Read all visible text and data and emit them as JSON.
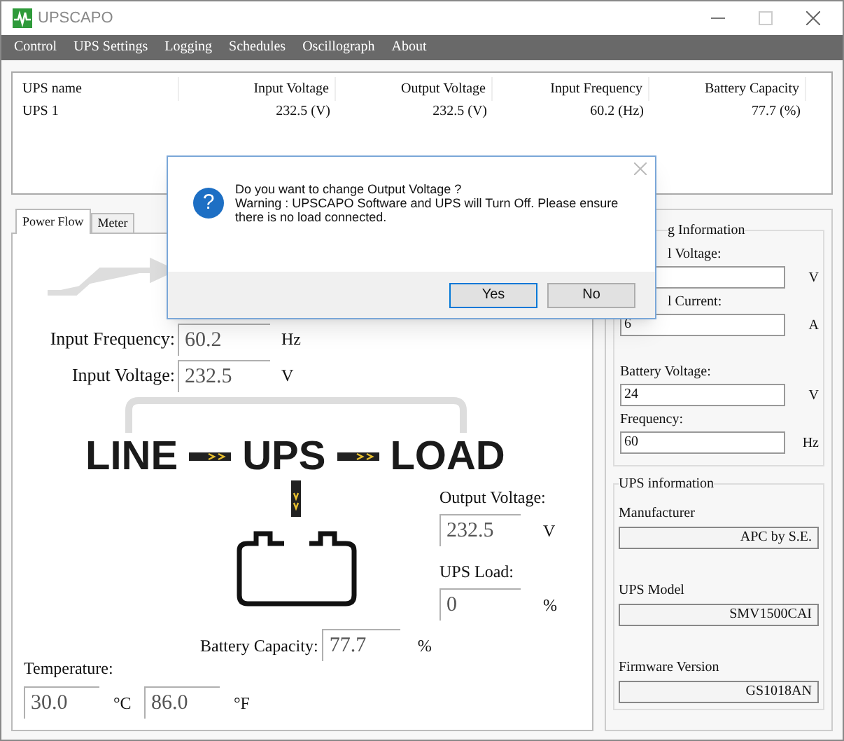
{
  "window": {
    "title": "UPSCAPO"
  },
  "menu": [
    "Control",
    "UPS Settings",
    "Logging",
    "Schedules",
    "Oscillograph",
    "About"
  ],
  "ups_list": {
    "columns": [
      "UPS name",
      "Input Voltage",
      "Output Voltage",
      "Input Frequency",
      "Battery Capacity"
    ],
    "rows": [
      [
        "UPS 1",
        "232.5 (V)",
        "232.5 (V)",
        "60.2 (Hz)",
        "77.7 (%)"
      ]
    ]
  },
  "tabs": [
    {
      "label": "Power Flow",
      "selected": true
    },
    {
      "label": "Meter",
      "selected": false
    }
  ],
  "power_flow": {
    "input_frequency": {
      "label": "Input Frequency:",
      "value": "60.2",
      "unit": "Hz"
    },
    "input_voltage": {
      "label": "Input Voltage:",
      "value": "232.5",
      "unit": "V"
    },
    "nodes": [
      "LINE",
      "UPS",
      "LOAD"
    ],
    "output_voltage": {
      "label": "Output Voltage:",
      "value": "232.5",
      "unit": "V"
    },
    "ups_load": {
      "label": "UPS Load:",
      "value": "0",
      "unit": "%"
    },
    "battery_capacity": {
      "label": "Battery Capacity:",
      "value": "77.7",
      "unit": "%"
    },
    "temperature": {
      "label": "Temperature:",
      "celsius": "30.0",
      "celsius_unit": "°C",
      "fahrenheit": "86.0",
      "fahrenheit_unit": "°F"
    }
  },
  "rating_information": {
    "title": "g Information",
    "fields": [
      {
        "label": "l Voltage:",
        "unit": "V"
      },
      {
        "label": "l Current:",
        "value": "6",
        "unit": "A"
      },
      {
        "label": "Battery Voltage:",
        "value": "24",
        "unit": "V"
      },
      {
        "label": "Frequency:",
        "value": "60",
        "unit": "Hz"
      }
    ]
  },
  "ups_information": {
    "title": "UPS information",
    "fields": [
      {
        "label": "Manufacturer",
        "value": "APC by S.E."
      },
      {
        "label": "UPS Model",
        "value": "SMV1500CAI"
      },
      {
        "label": "Firmware Version",
        "value": "GS1018AN"
      }
    ]
  },
  "dialog": {
    "icon": "?",
    "message": [
      "Do you want to change Output Voltage ?",
      "Warning : UPSCAPO Software and UPS will Turn Off. Please ensure there is no load connected."
    ],
    "buttons": [
      {
        "label": "Yes",
        "selected": true
      },
      {
        "label": "No",
        "selected": false
      }
    ]
  }
}
